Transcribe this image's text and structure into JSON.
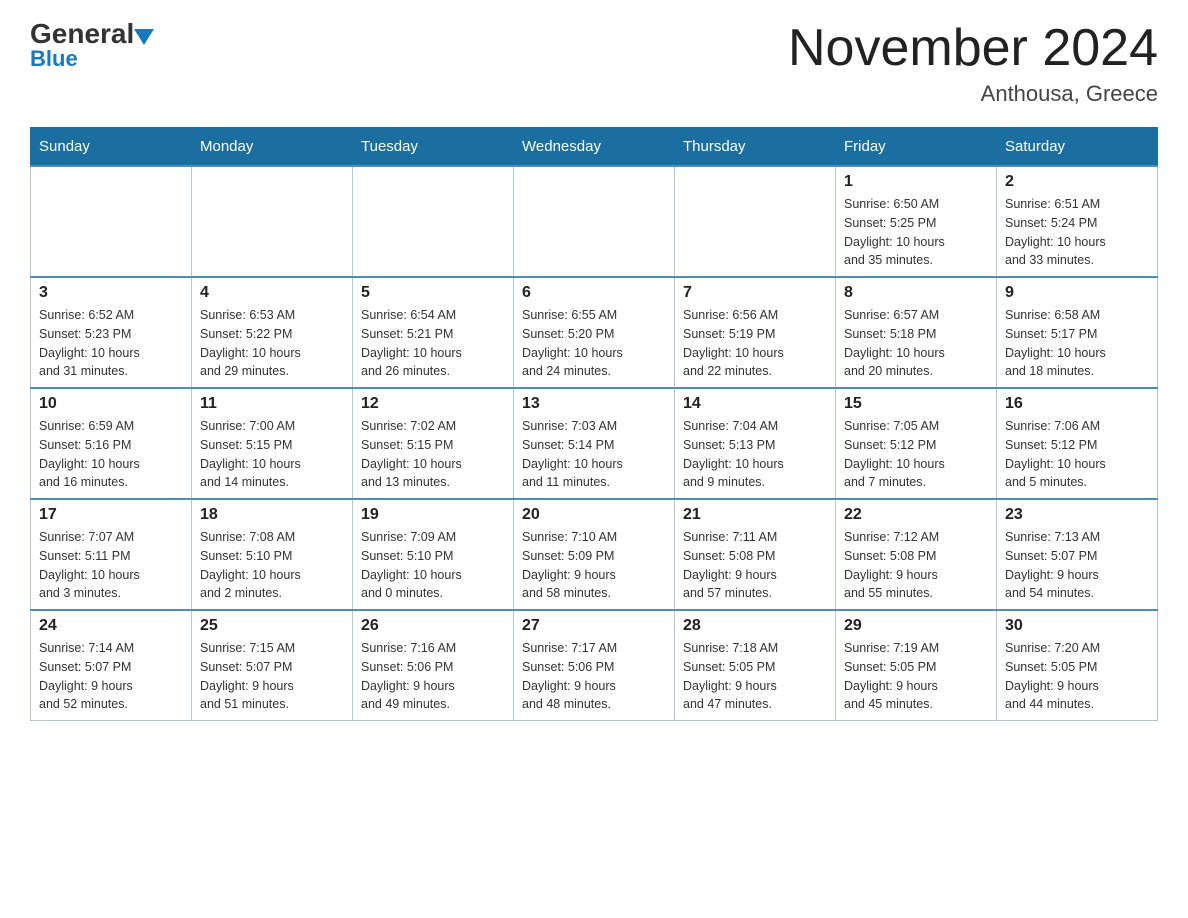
{
  "logo": {
    "general": "General",
    "blue": "Blue"
  },
  "header": {
    "title": "November 2024",
    "location": "Anthousa, Greece"
  },
  "weekdays": [
    "Sunday",
    "Monday",
    "Tuesday",
    "Wednesday",
    "Thursday",
    "Friday",
    "Saturday"
  ],
  "weeks": [
    [
      {
        "day": "",
        "info": ""
      },
      {
        "day": "",
        "info": ""
      },
      {
        "day": "",
        "info": ""
      },
      {
        "day": "",
        "info": ""
      },
      {
        "day": "",
        "info": ""
      },
      {
        "day": "1",
        "info": "Sunrise: 6:50 AM\nSunset: 5:25 PM\nDaylight: 10 hours\nand 35 minutes."
      },
      {
        "day": "2",
        "info": "Sunrise: 6:51 AM\nSunset: 5:24 PM\nDaylight: 10 hours\nand 33 minutes."
      }
    ],
    [
      {
        "day": "3",
        "info": "Sunrise: 6:52 AM\nSunset: 5:23 PM\nDaylight: 10 hours\nand 31 minutes."
      },
      {
        "day": "4",
        "info": "Sunrise: 6:53 AM\nSunset: 5:22 PM\nDaylight: 10 hours\nand 29 minutes."
      },
      {
        "day": "5",
        "info": "Sunrise: 6:54 AM\nSunset: 5:21 PM\nDaylight: 10 hours\nand 26 minutes."
      },
      {
        "day": "6",
        "info": "Sunrise: 6:55 AM\nSunset: 5:20 PM\nDaylight: 10 hours\nand 24 minutes."
      },
      {
        "day": "7",
        "info": "Sunrise: 6:56 AM\nSunset: 5:19 PM\nDaylight: 10 hours\nand 22 minutes."
      },
      {
        "day": "8",
        "info": "Sunrise: 6:57 AM\nSunset: 5:18 PM\nDaylight: 10 hours\nand 20 minutes."
      },
      {
        "day": "9",
        "info": "Sunrise: 6:58 AM\nSunset: 5:17 PM\nDaylight: 10 hours\nand 18 minutes."
      }
    ],
    [
      {
        "day": "10",
        "info": "Sunrise: 6:59 AM\nSunset: 5:16 PM\nDaylight: 10 hours\nand 16 minutes."
      },
      {
        "day": "11",
        "info": "Sunrise: 7:00 AM\nSunset: 5:15 PM\nDaylight: 10 hours\nand 14 minutes."
      },
      {
        "day": "12",
        "info": "Sunrise: 7:02 AM\nSunset: 5:15 PM\nDaylight: 10 hours\nand 13 minutes."
      },
      {
        "day": "13",
        "info": "Sunrise: 7:03 AM\nSunset: 5:14 PM\nDaylight: 10 hours\nand 11 minutes."
      },
      {
        "day": "14",
        "info": "Sunrise: 7:04 AM\nSunset: 5:13 PM\nDaylight: 10 hours\nand 9 minutes."
      },
      {
        "day": "15",
        "info": "Sunrise: 7:05 AM\nSunset: 5:12 PM\nDaylight: 10 hours\nand 7 minutes."
      },
      {
        "day": "16",
        "info": "Sunrise: 7:06 AM\nSunset: 5:12 PM\nDaylight: 10 hours\nand 5 minutes."
      }
    ],
    [
      {
        "day": "17",
        "info": "Sunrise: 7:07 AM\nSunset: 5:11 PM\nDaylight: 10 hours\nand 3 minutes."
      },
      {
        "day": "18",
        "info": "Sunrise: 7:08 AM\nSunset: 5:10 PM\nDaylight: 10 hours\nand 2 minutes."
      },
      {
        "day": "19",
        "info": "Sunrise: 7:09 AM\nSunset: 5:10 PM\nDaylight: 10 hours\nand 0 minutes."
      },
      {
        "day": "20",
        "info": "Sunrise: 7:10 AM\nSunset: 5:09 PM\nDaylight: 9 hours\nand 58 minutes."
      },
      {
        "day": "21",
        "info": "Sunrise: 7:11 AM\nSunset: 5:08 PM\nDaylight: 9 hours\nand 57 minutes."
      },
      {
        "day": "22",
        "info": "Sunrise: 7:12 AM\nSunset: 5:08 PM\nDaylight: 9 hours\nand 55 minutes."
      },
      {
        "day": "23",
        "info": "Sunrise: 7:13 AM\nSunset: 5:07 PM\nDaylight: 9 hours\nand 54 minutes."
      }
    ],
    [
      {
        "day": "24",
        "info": "Sunrise: 7:14 AM\nSunset: 5:07 PM\nDaylight: 9 hours\nand 52 minutes."
      },
      {
        "day": "25",
        "info": "Sunrise: 7:15 AM\nSunset: 5:07 PM\nDaylight: 9 hours\nand 51 minutes."
      },
      {
        "day": "26",
        "info": "Sunrise: 7:16 AM\nSunset: 5:06 PM\nDaylight: 9 hours\nand 49 minutes."
      },
      {
        "day": "27",
        "info": "Sunrise: 7:17 AM\nSunset: 5:06 PM\nDaylight: 9 hours\nand 48 minutes."
      },
      {
        "day": "28",
        "info": "Sunrise: 7:18 AM\nSunset: 5:05 PM\nDaylight: 9 hours\nand 47 minutes."
      },
      {
        "day": "29",
        "info": "Sunrise: 7:19 AM\nSunset: 5:05 PM\nDaylight: 9 hours\nand 45 minutes."
      },
      {
        "day": "30",
        "info": "Sunrise: 7:20 AM\nSunset: 5:05 PM\nDaylight: 9 hours\nand 44 minutes."
      }
    ]
  ]
}
